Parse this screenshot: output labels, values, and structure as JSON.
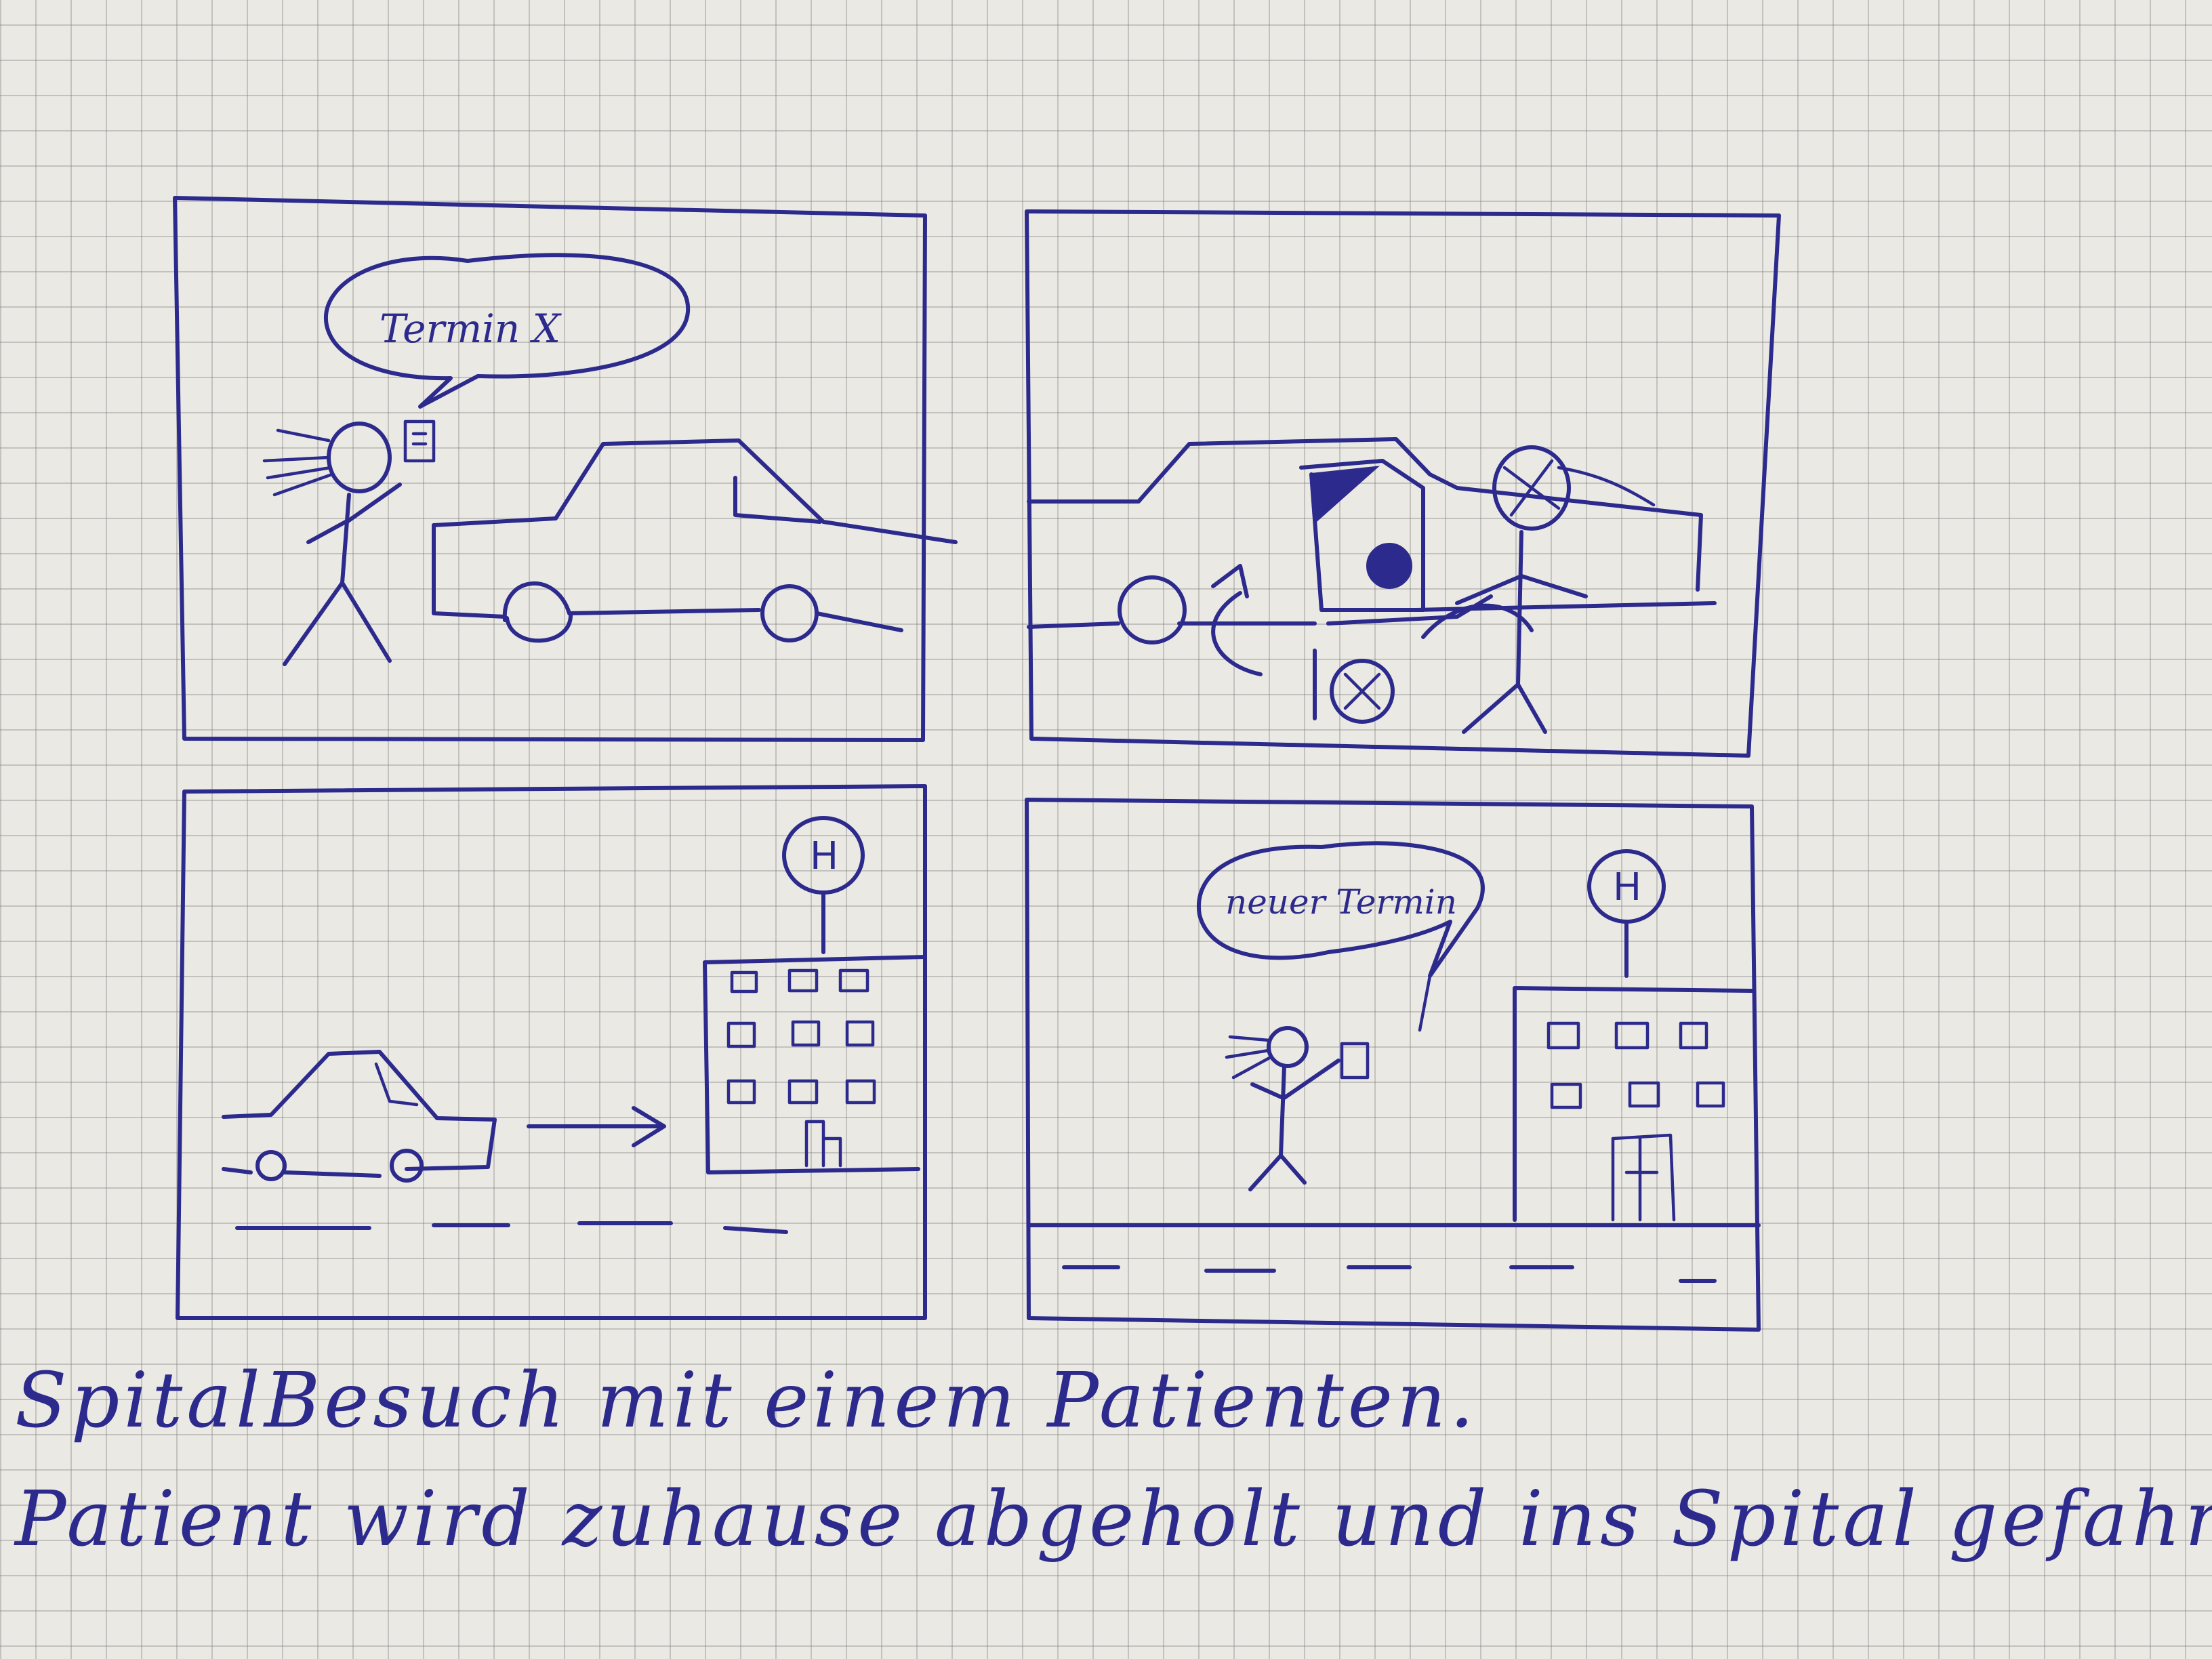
{
  "panels": [
    {
      "bubble": "Termin X"
    },
    {},
    {
      "sign": "H"
    },
    {
      "bubble": "neuer Termin",
      "sign": "H"
    }
  ],
  "caption": {
    "line1": "SpitalBesuch mit einem Patienten.",
    "line2": "Patient wird zuhause abgeholt und ins Spital gefahren."
  },
  "colors": {
    "ink": "#2c2a8c",
    "paper": "#ebe9e3"
  }
}
